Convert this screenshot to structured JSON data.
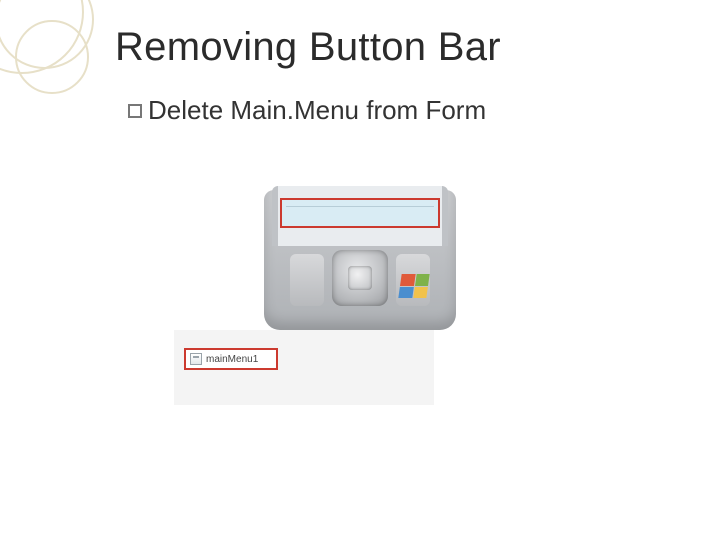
{
  "title": "Removing Button Bar",
  "bullet_text": "Delete Main.Menu from Form",
  "tray": {
    "component_label": "mainMenu1"
  }
}
